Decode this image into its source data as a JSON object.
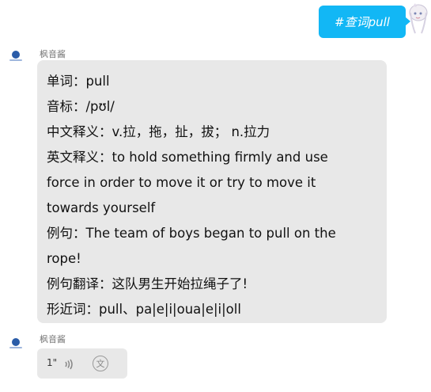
{
  "user_message": {
    "text": "#查词pull"
  },
  "bot": {
    "nickname": "枫音酱"
  },
  "reply": {
    "lines": [
      "单词：pull",
      "音标：/pʊl/",
      "中文释义：v.拉，拖，扯，拔；   n.拉力",
      "英文释义：to hold something firmly and use",
      "force in order to move it or try to move it",
      "towards yourself",
      "例句：The team of boys began to pull on the",
      "rope!",
      "例句翻译：这队男生开始拉绳子了!",
      "形近词：pull、pa|e|i|oua|e|i|oll"
    ]
  },
  "voice_message": {
    "duration": "1\"",
    "translate_icon_glyph": "文"
  },
  "icons": {
    "user_avatar": "anime-girl-avatar-icon",
    "bot_avatar": "bot-logo-avatar-icon",
    "voice": "sound-wave-icon",
    "translate": "translate-icon"
  },
  "colors": {
    "user_bubble": "#12b7f5",
    "bot_bubble": "#e8e8e8"
  }
}
